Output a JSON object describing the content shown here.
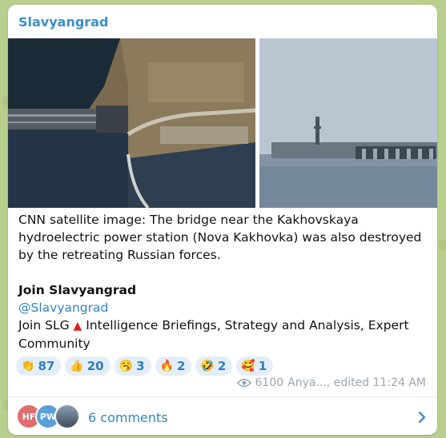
{
  "post": {
    "channel_name": "Slavyangrad",
    "caption_line1": "CNN satellite image: The bridge near the Kakhovskaya",
    "caption_line2": "hydroelectric power station (Nova Kakhovka) was also destroyed",
    "caption_line3": "by the retreating Russian forces.",
    "join_title": "Join Slavyangrad",
    "handle": "@Slavyangrad",
    "promo_prefix": "Join SLG",
    "promo_suffix": "Intelligence Briefings, Strategy and Analysis, Expert Community"
  },
  "reactions": [
    {
      "emoji": "👏",
      "count": "87"
    },
    {
      "emoji": "👍",
      "count": "20"
    },
    {
      "emoji": "🥱",
      "count": "3"
    },
    {
      "emoji": "🔥",
      "count": "2"
    },
    {
      "emoji": "🤣",
      "count": "2"
    },
    {
      "emoji": "🥰",
      "count": "1"
    }
  ],
  "meta": {
    "views": "6100",
    "author_edited": "Anya..., edited 11:24 AM"
  },
  "comments": {
    "avatar1_initials": "HF",
    "avatar2_initials": "PW",
    "label": "6 comments"
  },
  "colors": {
    "accent": "#2f86c5",
    "background": "#b9cf8e",
    "reaction_bg": "#e4eef8"
  }
}
